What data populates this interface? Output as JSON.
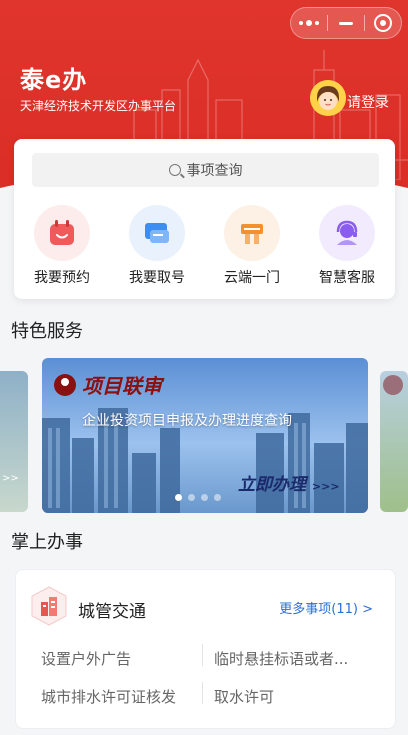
{
  "header": {
    "brand": "泰e办",
    "subtitle": "天津经济技术开发区办事平台",
    "login_label": "请登录"
  },
  "search": {
    "placeholder": "事项查询",
    "icon": "search-icon"
  },
  "quick_actions": [
    {
      "label": "我要预约",
      "icon": "calendar-icon",
      "color": "#f05a5a"
    },
    {
      "label": "我要取号",
      "icon": "ticket-icon",
      "color": "#3d8ef0"
    },
    {
      "label": "云端一门",
      "icon": "gate-icon",
      "color": "#f5902e"
    },
    {
      "label": "智慧客服",
      "icon": "customer-service-icon",
      "color": "#8a5cf0"
    }
  ],
  "featured": {
    "title": "特色服务",
    "banner": {
      "tag": "项目联审",
      "description": "企业投资项目申报及办理进度查询",
      "cta": "立即办理",
      "cta_suffix": ">>>"
    },
    "carousel_total": 4,
    "carousel_active": 1
  },
  "handheld": {
    "title": "掌上办事",
    "category": {
      "title": "城管交通",
      "more_label": "更多事项(11) >",
      "items": [
        "设置户外广告",
        "临时悬挂标语或者...",
        "城市排水许可证核发",
        "取水许可"
      ]
    }
  },
  "colors": {
    "primary": "#d92d26",
    "link": "#2a6fd6"
  }
}
